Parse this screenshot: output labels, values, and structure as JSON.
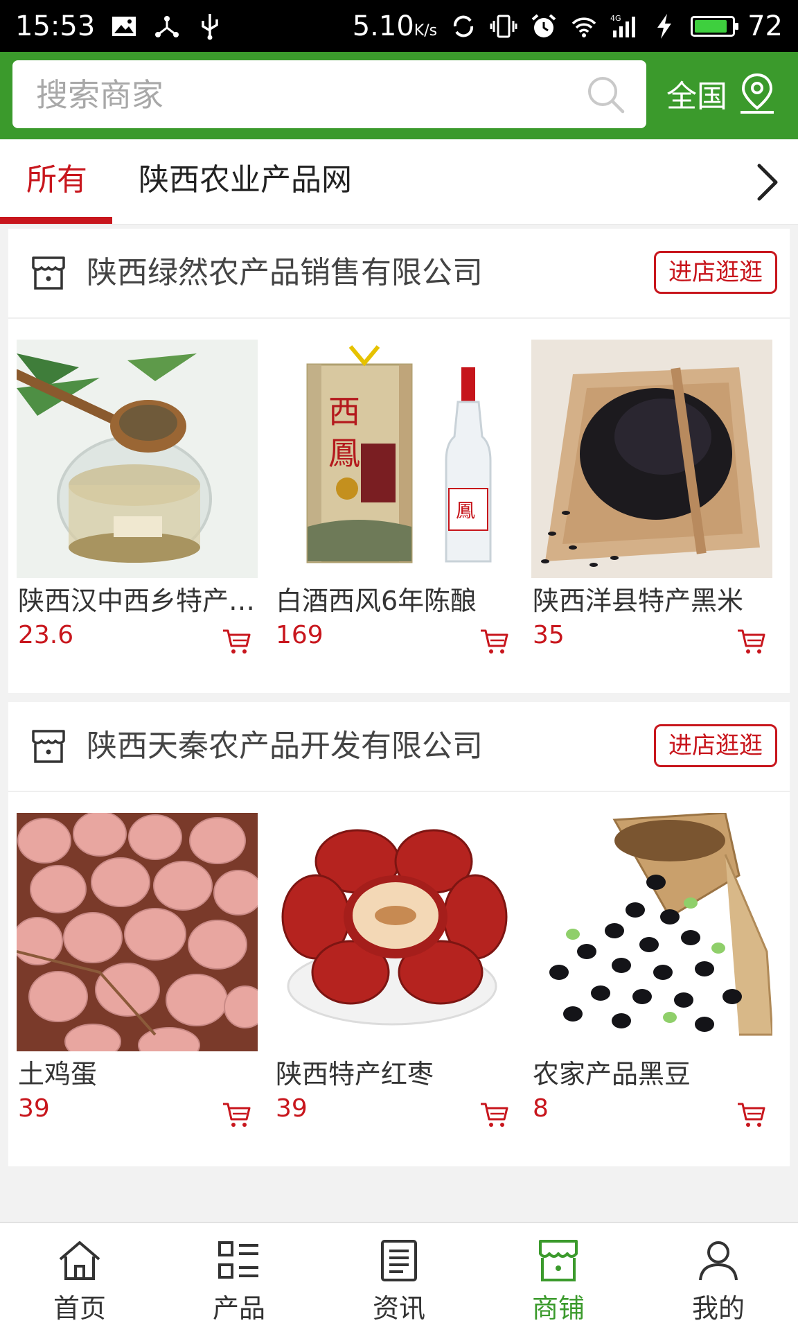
{
  "status_bar": {
    "time": "15:53",
    "speed": "5.10",
    "speed_unit": "K/s",
    "battery": "72",
    "network": "4G"
  },
  "header": {
    "search_placeholder": "搜索商家",
    "region_label": "全国",
    "accent_color": "#3b9a2c"
  },
  "tabs": {
    "items": [
      {
        "label": "所有",
        "active": true
      },
      {
        "label": "陕西农业产品网",
        "active": false
      }
    ]
  },
  "shops": [
    {
      "name": "陕西绿然农产品销售有限公司",
      "enter_label": "进店逛逛",
      "products": [
        {
          "name": "陕西汉中西乡特产…",
          "price": "23.6",
          "image": "barley-tea-glass"
        },
        {
          "name": "白酒西风6年陈酿",
          "price": "169",
          "image": "liquor-box-bottle"
        },
        {
          "name": "陕西洋县特产黑米",
          "price": "35",
          "image": "black-rice-tray"
        }
      ]
    },
    {
      "name": "陕西天秦农产品开发有限公司",
      "enter_label": "进店逛逛",
      "products": [
        {
          "name": "土鸡蛋",
          "price": "39",
          "image": "eggs-pile"
        },
        {
          "name": "陕西特产红枣",
          "price": "39",
          "image": "red-dates-bowl"
        },
        {
          "name": "农家产品黑豆",
          "price": "8",
          "image": "black-beans-cup"
        }
      ]
    }
  ],
  "bottom_nav": {
    "items": [
      {
        "label": "首页",
        "icon": "home-icon",
        "active": false
      },
      {
        "label": "产品",
        "icon": "grid-list-icon",
        "active": false
      },
      {
        "label": "资讯",
        "icon": "news-icon",
        "active": false
      },
      {
        "label": "商铺",
        "icon": "shop-icon",
        "active": true
      },
      {
        "label": "我的",
        "icon": "user-icon",
        "active": false
      }
    ]
  },
  "colors": {
    "brand_green": "#3b9a2c",
    "price_red": "#c8161d",
    "background": "#f2f2f2"
  }
}
